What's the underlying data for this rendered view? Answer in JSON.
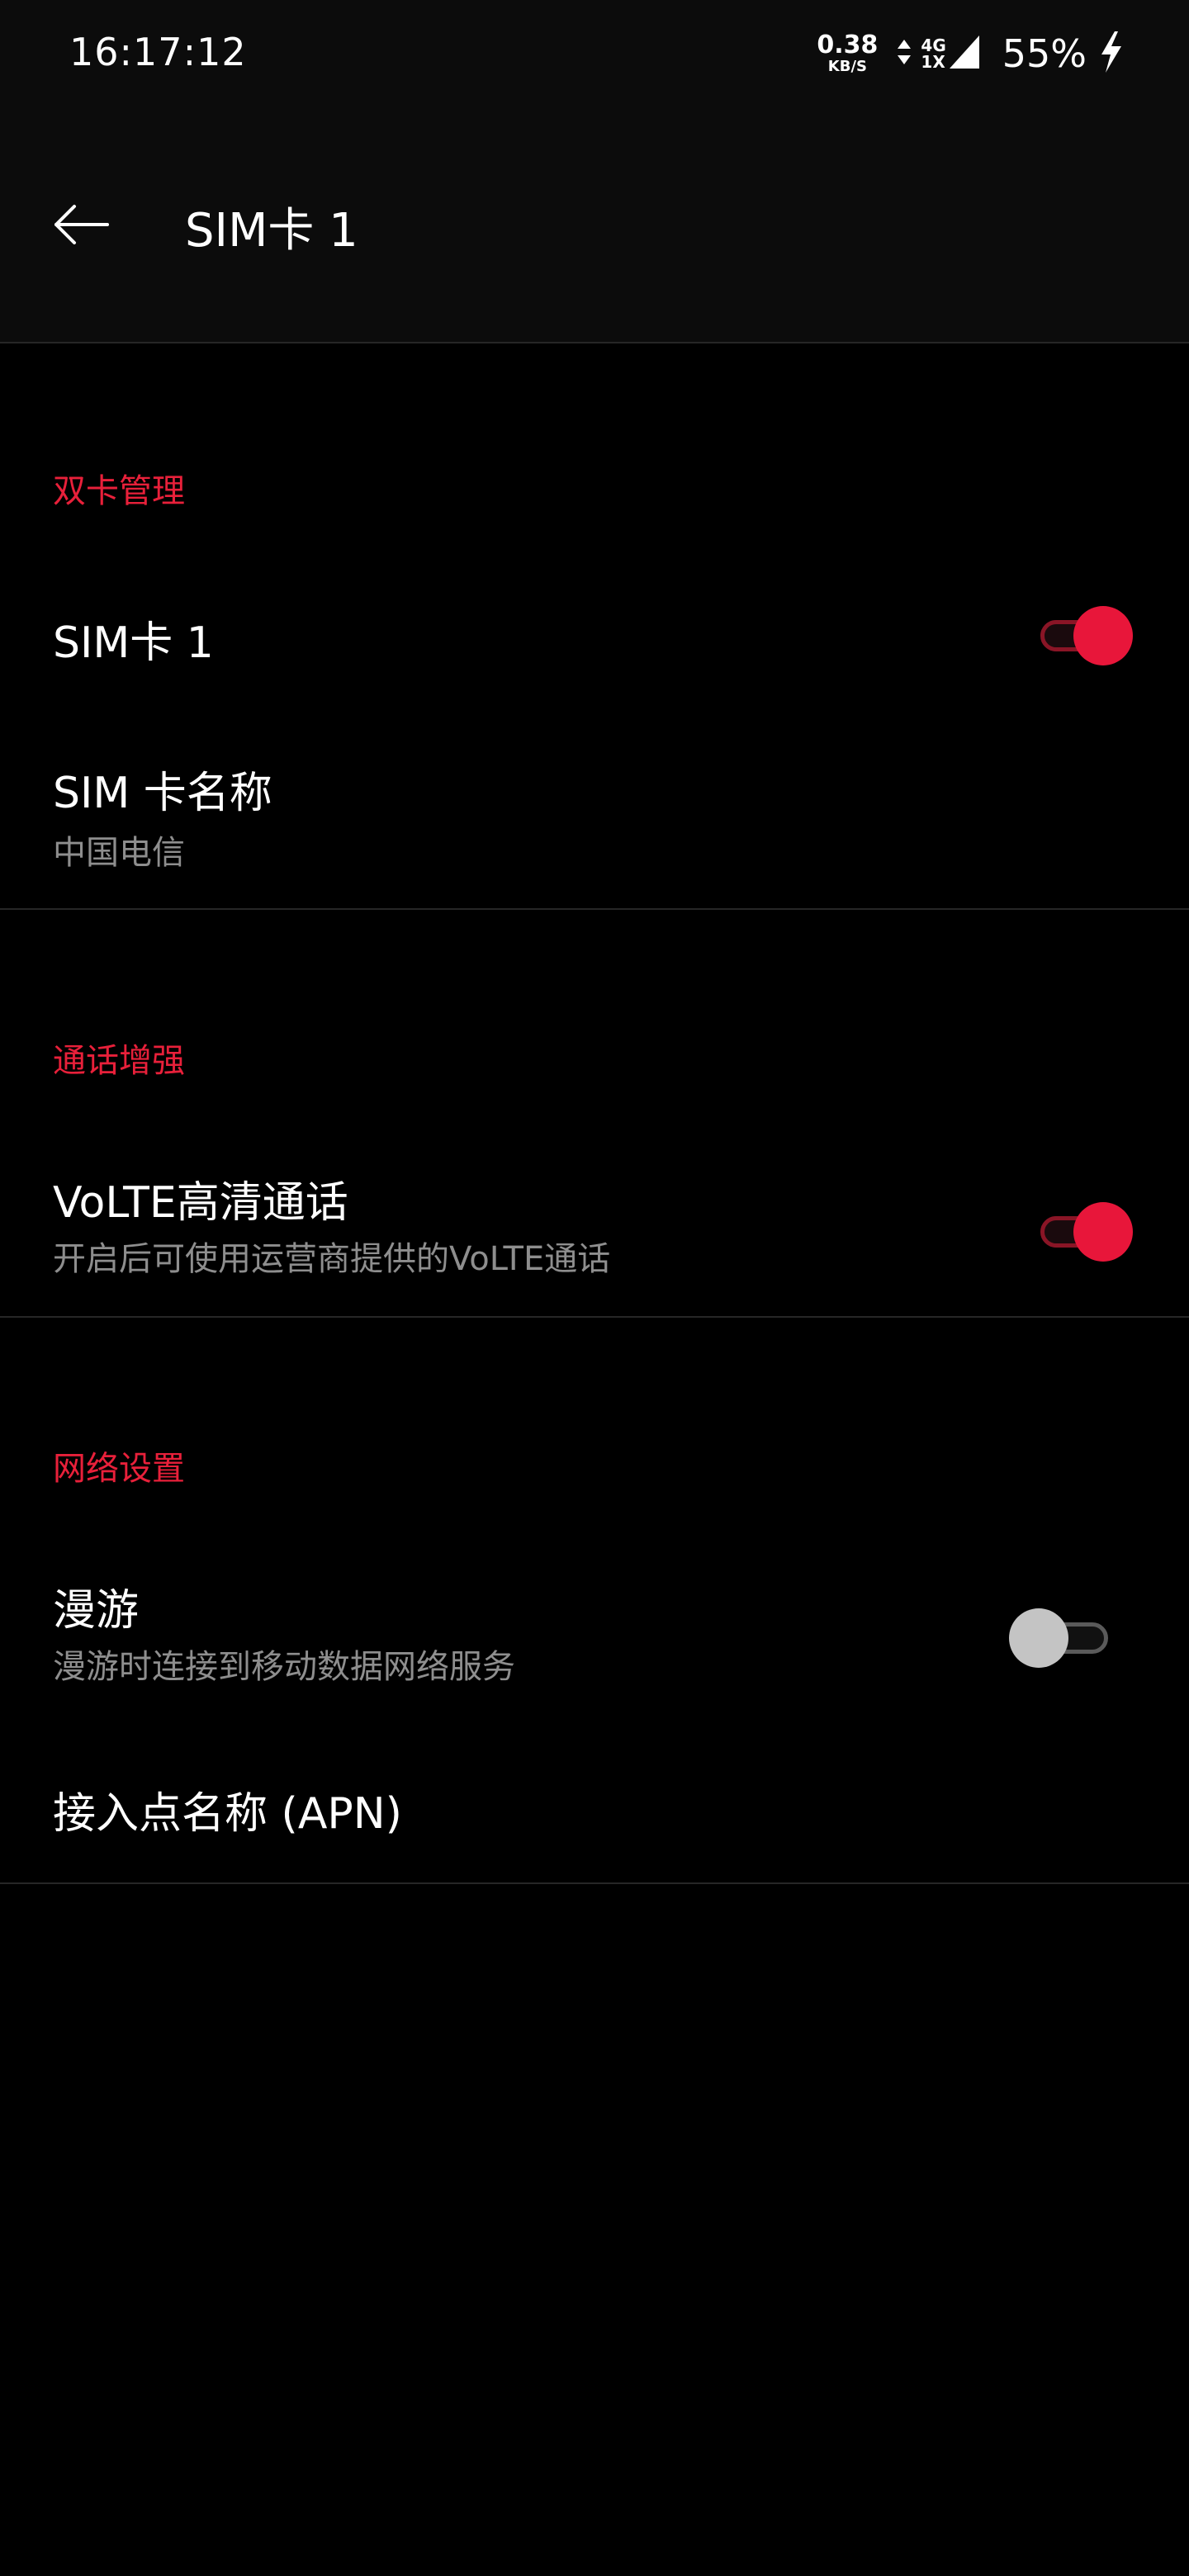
{
  "status_bar": {
    "time": "16:17:12",
    "net_speed_value": "0.38",
    "net_speed_unit": "KB/S",
    "net_type_top": "4G",
    "net_type_bottom": "1X",
    "battery": "55%"
  },
  "app_bar": {
    "title": "SIM卡 1"
  },
  "sections": {
    "dual_sim": {
      "header": "双卡管理",
      "sim1_label": "SIM卡 1",
      "sim1_enabled": true,
      "sim_name_label": "SIM 卡名称",
      "sim_name_value": "中国电信"
    },
    "call_enhance": {
      "header": "通话增强",
      "volte_label": "VoLTE高清通话",
      "volte_desc": "开启后可使用运营商提供的VoLTE通话",
      "volte_enabled": true
    },
    "network": {
      "header": "网络设置",
      "roaming_label": "漫游",
      "roaming_desc": "漫游时连接到移动数据网络服务",
      "roaming_enabled": false,
      "apn_label": "接入点名称 (APN)"
    }
  },
  "colors": {
    "accent": "#e8203a",
    "background": "#000000",
    "bar_background": "#0c0c0c",
    "secondary_text": "#8e8e8e",
    "divider": "#262626"
  },
  "icons": {
    "back": "arrow-left-icon",
    "charging": "lightning-bolt-icon",
    "signal": "cellular-signal-icon",
    "data_activity": "up-down-arrows-icon"
  }
}
